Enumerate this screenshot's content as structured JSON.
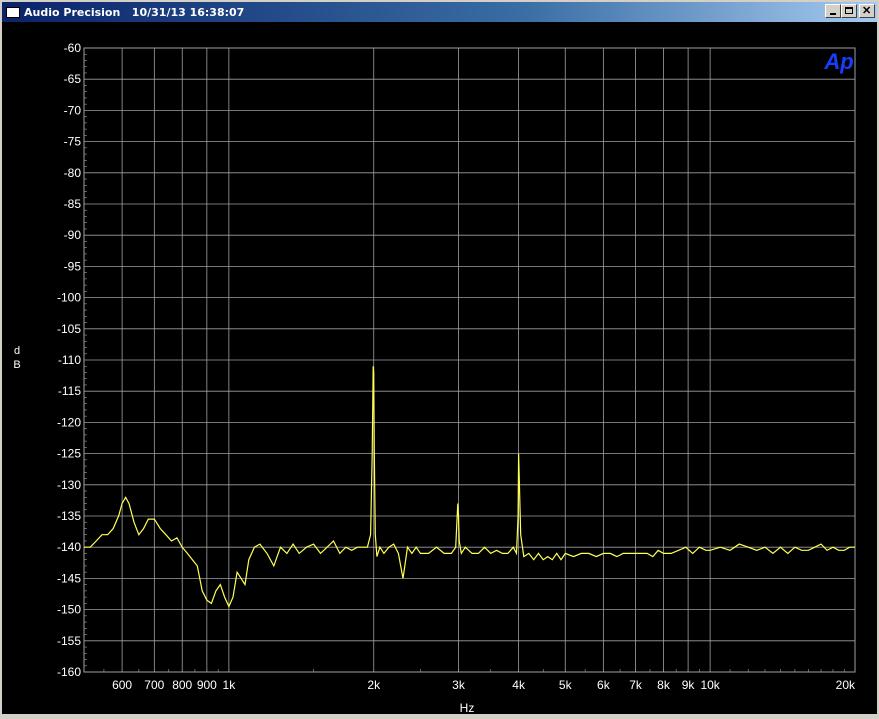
{
  "window": {
    "title": "Audio Precision   10/31/13 16:38:07",
    "minimize_label": "_",
    "maximize_label": "□",
    "close_label": "×"
  },
  "logo": {
    "text": "Ap",
    "color": "#1a3cff"
  },
  "colors": {
    "background": "#000000",
    "grid": "#a0a0a0",
    "trace": "#ffff55",
    "text": "#ffffff"
  },
  "chart_data": {
    "type": "line",
    "title": "",
    "xlabel": "Hz",
    "ylabel": "d\nB",
    "xscale": "log",
    "xlim": [
      500,
      20000
    ],
    "ylim": [
      -160,
      -60
    ],
    "grid": true,
    "legend": "none",
    "yticks": [
      -60,
      -65,
      -70,
      -75,
      -80,
      -85,
      -90,
      -95,
      -100,
      -105,
      -110,
      -115,
      -120,
      -125,
      -130,
      -135,
      -140,
      -145,
      -150,
      -155,
      -160
    ],
    "xticks": [
      {
        "value": 600,
        "label": "600"
      },
      {
        "value": 700,
        "label": "700"
      },
      {
        "value": 800,
        "label": "800"
      },
      {
        "value": 900,
        "label": "900"
      },
      {
        "value": 1000,
        "label": "1k"
      },
      {
        "value": 2000,
        "label": "2k"
      },
      {
        "value": 3000,
        "label": "3k"
      },
      {
        "value": 4000,
        "label": "4k"
      },
      {
        "value": 5000,
        "label": "5k"
      },
      {
        "value": 6000,
        "label": "6k"
      },
      {
        "value": 7000,
        "label": "7k"
      },
      {
        "value": 8000,
        "label": "8k"
      },
      {
        "value": 9000,
        "label": "9k"
      },
      {
        "value": 10000,
        "label": "10k"
      },
      {
        "value": 20000,
        "label": "20k"
      }
    ],
    "series": [
      {
        "color": "#ffff55",
        "x": [
          500,
          515,
          530,
          545,
          560,
          575,
          590,
          600,
          610,
          620,
          635,
          650,
          665,
          680,
          700,
          720,
          740,
          760,
          780,
          800,
          820,
          840,
          860,
          880,
          900,
          920,
          940,
          960,
          980,
          1000,
          1020,
          1040,
          1060,
          1080,
          1100,
          1130,
          1160,
          1200,
          1240,
          1280,
          1320,
          1360,
          1400,
          1450,
          1500,
          1550,
          1600,
          1650,
          1700,
          1750,
          1800,
          1850,
          1900,
          1940,
          1970,
          1985,
          1995,
          2000,
          2005,
          2015,
          2030,
          2060,
          2100,
          2150,
          2200,
          2250,
          2300,
          2350,
          2400,
          2450,
          2500,
          2600,
          2700,
          2800,
          2900,
          2960,
          2990,
          3000,
          3010,
          3040,
          3100,
          3200,
          3300,
          3400,
          3500,
          3600,
          3700,
          3800,
          3900,
          3960,
          3990,
          4000,
          4010,
          4040,
          4100,
          4200,
          4300,
          4400,
          4500,
          4600,
          4700,
          4800,
          4900,
          5000,
          5200,
          5400,
          5600,
          5800,
          6000,
          6200,
          6400,
          6600,
          6800,
          7000,
          7200,
          7400,
          7600,
          7800,
          8000,
          8300,
          8600,
          8900,
          9200,
          9500,
          9800,
          10000,
          10500,
          11000,
          11500,
          12000,
          12500,
          13000,
          13500,
          14000,
          14500,
          15000,
          15500,
          16000,
          16500,
          17000,
          17500,
          18000,
          18500,
          19000,
          19500,
          20000
        ],
        "y": [
          -140,
          -140,
          -139,
          -138,
          -138,
          -137,
          -135,
          -133,
          -132,
          -133,
          -136,
          -138,
          -137,
          -135.5,
          -135.5,
          -137,
          -138,
          -139,
          -138.5,
          -140,
          -141,
          -142,
          -143,
          -147,
          -148.5,
          -149,
          -147,
          -146,
          -148,
          -149.5,
          -148,
          -144,
          -145,
          -146,
          -142,
          -140,
          -139.5,
          -141,
          -143,
          -140,
          -141,
          -139.5,
          -141,
          -140,
          -139.5,
          -141,
          -140,
          -139,
          -141,
          -140,
          -140.5,
          -140,
          -140,
          -140,
          -138,
          -125,
          -111,
          -112,
          -125,
          -138,
          -141.5,
          -140,
          -141,
          -140,
          -139.5,
          -141,
          -145,
          -140,
          -141,
          -140,
          -141,
          -141,
          -140,
          -141,
          -141,
          -140,
          -133,
          -135,
          -139,
          -141,
          -140,
          -141,
          -141,
          -140,
          -141,
          -140.5,
          -141,
          -141,
          -140,
          -141,
          -135,
          -125,
          -128,
          -138,
          -141.5,
          -141,
          -142,
          -141,
          -142,
          -141.5,
          -142,
          -141,
          -142,
          -141,
          -141.5,
          -141,
          -141,
          -141.5,
          -141,
          -141,
          -141.5,
          -141,
          -141,
          -141,
          -141,
          -141,
          -141.5,
          -140.5,
          -141,
          -141,
          -140.5,
          -140,
          -141,
          -140,
          -140.5,
          -140.5,
          -140,
          -140.5,
          -139.5,
          -140,
          -140.5,
          -140,
          -141,
          -140,
          -141,
          -140,
          -140.5,
          -140.5,
          -140,
          -139.5,
          -140.5,
          -140,
          -140.5,
          -140.5,
          -140,
          -140
        ]
      }
    ]
  }
}
